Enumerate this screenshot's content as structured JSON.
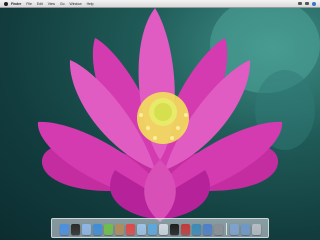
{
  "menubar": {
    "app_name": "Finder",
    "menus": [
      "File",
      "Edit",
      "View",
      "Go",
      "Window",
      "Help"
    ]
  },
  "dock": {
    "items": [
      {
        "name": "finder-icon",
        "color": "#4a90e2"
      },
      {
        "name": "dashboard-icon",
        "color": "#2b2b2b"
      },
      {
        "name": "mail-icon",
        "color": "#8fb7e6"
      },
      {
        "name": "safari-icon",
        "color": "#3e8ed8"
      },
      {
        "name": "ichat-icon",
        "color": "#6fbf4a"
      },
      {
        "name": "address-book-icon",
        "color": "#b08c5a"
      },
      {
        "name": "ical-icon",
        "color": "#e04848"
      },
      {
        "name": "preview-icon",
        "color": "#9ec3e6"
      },
      {
        "name": "itunes-icon",
        "color": "#5ba8e0"
      },
      {
        "name": "iphoto-icon",
        "color": "#cfd8e0"
      },
      {
        "name": "front-row-icon",
        "color": "#1e1e1e"
      },
      {
        "name": "photo-booth-icon",
        "color": "#c23a3a"
      },
      {
        "name": "time-machine-icon",
        "color": "#3a8ab8"
      },
      {
        "name": "spaces-icon",
        "color": "#4d7fc9"
      },
      {
        "name": "system-preferences-icon",
        "color": "#8a8f96"
      }
    ],
    "right_items": [
      {
        "name": "applications-stack-icon",
        "color": "#7ea3cf"
      },
      {
        "name": "downloads-stack-icon",
        "color": "#6f98c8"
      },
      {
        "name": "trash-icon",
        "color": "#b5bcc4"
      }
    ]
  }
}
